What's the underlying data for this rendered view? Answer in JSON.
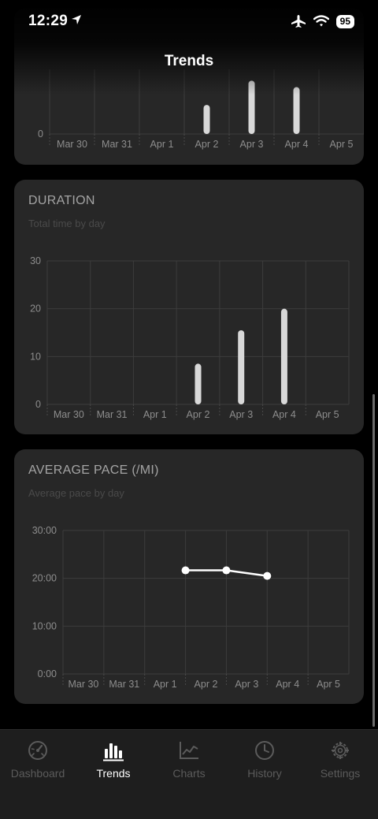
{
  "status_bar": {
    "time": "12:29",
    "battery": "95"
  },
  "nav": {
    "title": "Trends"
  },
  "top_chart": {
    "chart_data": {
      "type": "bar",
      "categories": [
        "Mar 30",
        "Mar 31",
        "Apr 1",
        "Apr 2",
        "Apr 3",
        "Apr 4",
        "Apr 5"
      ],
      "values": [
        0,
        0,
        0,
        1.8,
        3.3,
        2.9,
        0
      ],
      "y_zero_label": "0",
      "grid": true
    }
  },
  "duration_card": {
    "title": "DURATION",
    "subtitle": "Total time by day",
    "chart_data": {
      "type": "bar",
      "categories": [
        "Mar 30",
        "Mar 31",
        "Apr 1",
        "Apr 2",
        "Apr 3",
        "Apr 4",
        "Apr 5"
      ],
      "values": [
        0,
        0,
        0,
        8.5,
        15.5,
        20,
        0
      ],
      "yticks": [
        "0",
        "10",
        "20",
        "30"
      ],
      "ylim": [
        0,
        30
      ],
      "grid": true
    }
  },
  "pace_card": {
    "title": "AVERAGE PACE (/MI)",
    "subtitle": "Average pace by day",
    "chart_data": {
      "type": "line",
      "categories": [
        "Mar 30",
        "Mar 31",
        "Apr 1",
        "Apr 2",
        "Apr 3",
        "Apr 4",
        "Apr 5"
      ],
      "values": [
        null,
        null,
        null,
        21.67,
        21.67,
        20.5,
        null
      ],
      "yticks": [
        "0:00",
        "10:00",
        "20:00",
        "30:00"
      ],
      "ylim": [
        0,
        30
      ],
      "grid": true
    }
  },
  "tab_bar": {
    "tabs": [
      {
        "label": "Dashboard",
        "icon": "gauge-icon",
        "active": false
      },
      {
        "label": "Trends",
        "icon": "bar-chart-icon",
        "active": true
      },
      {
        "label": "Charts",
        "icon": "line-chart-icon",
        "active": false
      },
      {
        "label": "History",
        "icon": "clock-icon",
        "active": false
      },
      {
        "label": "Settings",
        "icon": "gear-icon",
        "active": false
      }
    ]
  },
  "colors": {
    "background": "#000000",
    "card": "#272727",
    "bar": "#d8d8d8",
    "line": "#ffffff",
    "inactive": "#5b5b5b"
  }
}
